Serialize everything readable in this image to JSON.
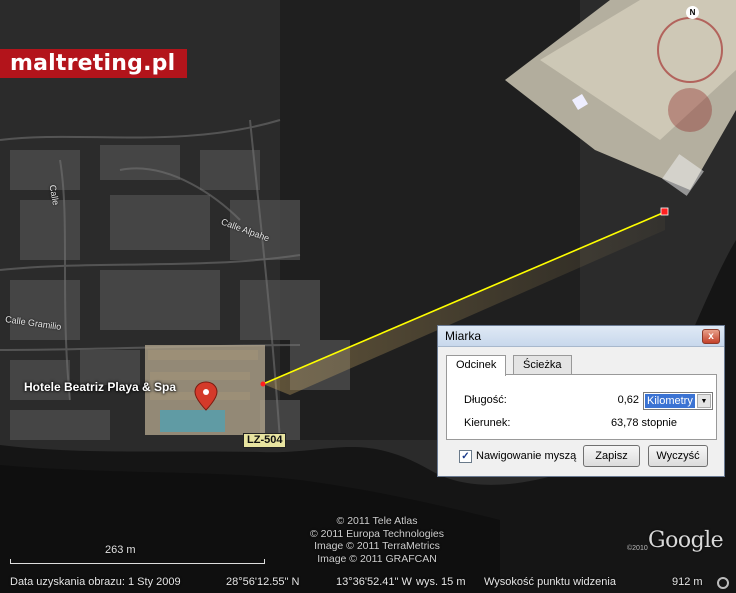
{
  "brand": {
    "text": "maltreting.pl",
    "color": "#b3141b"
  },
  "map": {
    "place_label": "Hotele Beatriz Playa & Spa",
    "road_badge": "LZ-504",
    "streets": [
      {
        "name": "Calle Alpahe"
      },
      {
        "name": "Calle Gramilio"
      },
      {
        "name": "Calle"
      }
    ],
    "compass": "N",
    "measure_line_color": "#ffff00"
  },
  "copyright": {
    "lines": [
      "© 2011 Tele Atlas",
      "© 2011 Europa Technologies",
      "Image © 2011 TerraMetrics",
      "Image © 2011 GRAFCAN"
    ]
  },
  "logo": {
    "text": "Google",
    "year": "©2010"
  },
  "scale": {
    "label": "263 m"
  },
  "statusbar": {
    "date": "Data uzyskania obrazu:   1 Sty 2009",
    "lat": "28°56'12.55\" N",
    "lon": "13°36'52.41\" W",
    "elev": "wys.   15 m",
    "eye": "Wysokość punktu widzenia",
    "eye_value": "912 m"
  },
  "dialog": {
    "title": "Miarka",
    "close": "x",
    "tabs": [
      {
        "label": "Odcinek",
        "active": true
      },
      {
        "label": "Ścieżka",
        "active": false
      }
    ],
    "length_label": "Długość:",
    "length_value": "0,62",
    "unit": "Kilometry",
    "heading_label": "Kierunek:",
    "heading_value": "63,78 stopnie",
    "checkbox_label": "Nawigowanie myszą",
    "checkbox_checked": true,
    "save": "Zapisz",
    "clear": "Wyczyść"
  }
}
